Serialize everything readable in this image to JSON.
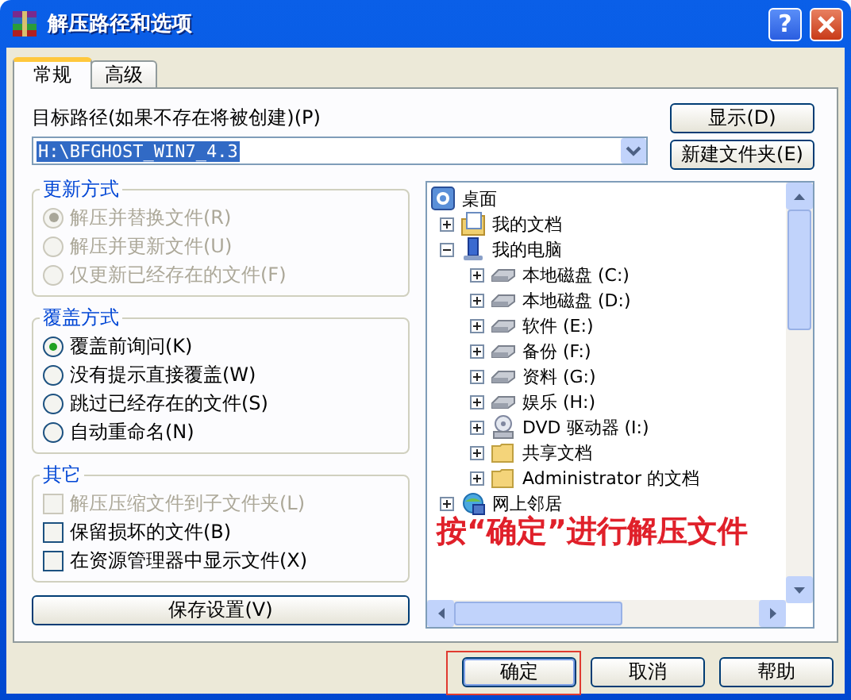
{
  "window": {
    "title": "解压路径和选项",
    "help_glyph": "?"
  },
  "tabs": [
    {
      "label": "常规",
      "selected": true
    },
    {
      "label": "高级",
      "selected": false
    }
  ],
  "path": {
    "label": "目标路径(如果不存在将被创建)(P)",
    "value": "H:\\BFGHOST_WIN7_4.3"
  },
  "side_buttons": [
    "显示(D)",
    "新建文件夹(E)"
  ],
  "groups": [
    {
      "title": "更新方式",
      "options": [
        {
          "kind": "radio",
          "label": "解压并替换文件(R)",
          "selected": true,
          "disabled": true
        },
        {
          "kind": "radio",
          "label": "解压并更新文件(U)",
          "selected": false,
          "disabled": true
        },
        {
          "kind": "radio",
          "label": "仅更新已经存在的文件(F)",
          "selected": false,
          "disabled": true
        }
      ]
    },
    {
      "title": "覆盖方式",
      "options": [
        {
          "kind": "radio",
          "label": "覆盖前询问(K)",
          "selected": true,
          "disabled": false
        },
        {
          "kind": "radio",
          "label": "没有提示直接覆盖(W)",
          "selected": false,
          "disabled": false
        },
        {
          "kind": "radio",
          "label": "跳过已经存在的文件(S)",
          "selected": false,
          "disabled": false
        },
        {
          "kind": "radio",
          "label": "自动重命名(N)",
          "selected": false,
          "disabled": false
        }
      ]
    },
    {
      "title": "其它",
      "options": [
        {
          "kind": "checkbox",
          "label": "解压压缩文件到子文件夹(L)",
          "checked": false,
          "disabled": true
        },
        {
          "kind": "checkbox",
          "label": "保留损坏的文件(B)",
          "checked": false,
          "disabled": false
        },
        {
          "kind": "checkbox",
          "label": "在资源管理器中显示文件(X)",
          "checked": false,
          "disabled": false
        }
      ]
    }
  ],
  "save_button": "保存设置(V)",
  "tree": {
    "label": "桌面",
    "kind": "desktop",
    "children": [
      {
        "label": "我的文档",
        "kind": "documents",
        "expanded": false
      },
      {
        "label": "我的电脑",
        "kind": "computer",
        "expanded": true,
        "children": [
          {
            "label": "本地磁盘 (C:)",
            "kind": "drive",
            "expanded": false
          },
          {
            "label": "本地磁盘 (D:)",
            "kind": "drive",
            "expanded": false
          },
          {
            "label": "软件 (E:)",
            "kind": "drive",
            "expanded": false
          },
          {
            "label": "备份 (F:)",
            "kind": "drive",
            "expanded": false
          },
          {
            "label": "资料 (G:)",
            "kind": "drive",
            "expanded": false
          },
          {
            "label": "娱乐 (H:)",
            "kind": "drive",
            "expanded": false
          },
          {
            "label": "DVD 驱动器 (I:)",
            "kind": "dvd",
            "expanded": false
          },
          {
            "label": "共享文档",
            "kind": "folder",
            "expanded": false
          },
          {
            "label": "Administrator 的文档",
            "kind": "folder",
            "expanded": false
          }
        ]
      },
      {
        "label": "网上邻居",
        "kind": "network",
        "expanded": false
      }
    ]
  },
  "annotation": "按“确定”进行解压文件",
  "buttons": [
    {
      "label": "确定",
      "highlighted": true
    },
    {
      "label": "取消",
      "highlighted": false
    },
    {
      "label": "帮助",
      "highlighted": false
    }
  ]
}
